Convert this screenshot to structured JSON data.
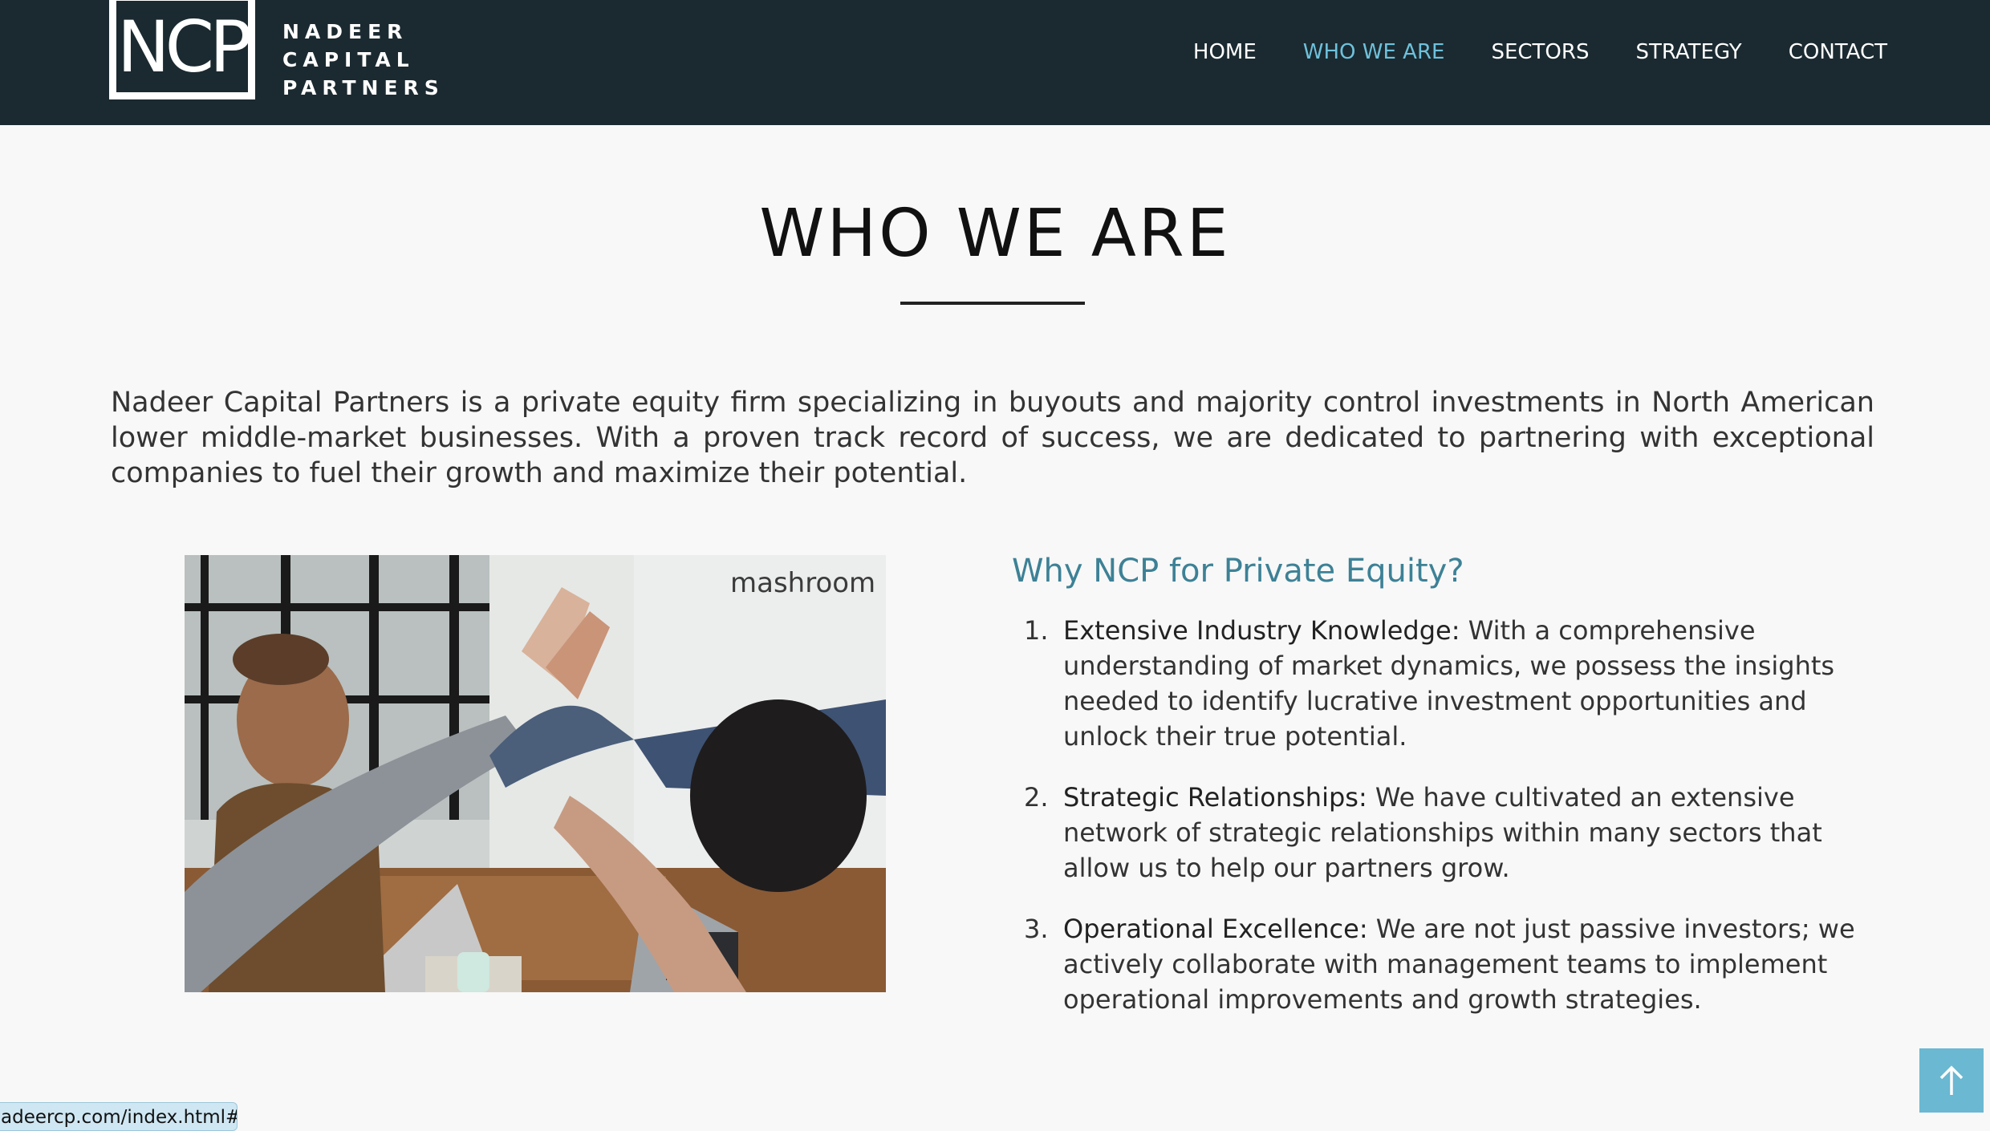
{
  "header": {
    "logo_mark": "NCP",
    "logo_lines": [
      "NADEER",
      "CAPITAL",
      "PARTNERS"
    ],
    "nav": [
      {
        "label": "HOME",
        "active": false
      },
      {
        "label": "WHO WE ARE",
        "active": true
      },
      {
        "label": "SECTORS",
        "active": false
      },
      {
        "label": "STRATEGY",
        "active": false
      },
      {
        "label": "CONTACT",
        "active": false
      }
    ]
  },
  "main": {
    "title": "WHO WE ARE",
    "intro": "Nadeer Capital Partners is a private equity firm specializing in buyouts and majority control investments in North American lower middle-market businesses. With a proven track record of success, we are dedicated to partnering with exceptional companies to fuel their growth and maximize their potential.",
    "photo_sign_text": "mashroom",
    "why_heading": "Why NCP for Private Equity?",
    "why_items": [
      {
        "num": "1.",
        "term": "Extensive Industry Knowledge:",
        "text": " With a comprehensive understanding of market dynamics, we possess the insights needed to identify lucrative investment opportunities and unlock their true potential."
      },
      {
        "num": "2.",
        "term": "Strategic Relationships:",
        "text": " We have cultivated an extensive network of strategic relationships within many sectors that allow us to help our partners grow."
      },
      {
        "num": "3.",
        "term": "Operational Excellence:",
        "text": " We are not just passive investors; we actively collaborate with management teams to implement operational improvements and growth strategies."
      }
    ]
  },
  "status_url": "adeercp.com/index.html#",
  "colors": {
    "nav_bg": "#1b2a30",
    "accent": "#6ec1dc",
    "heading_teal": "#3d8196",
    "scroll_button": "#6ab8d2"
  },
  "icons": {
    "scroll_top": "arrow-up-icon"
  }
}
